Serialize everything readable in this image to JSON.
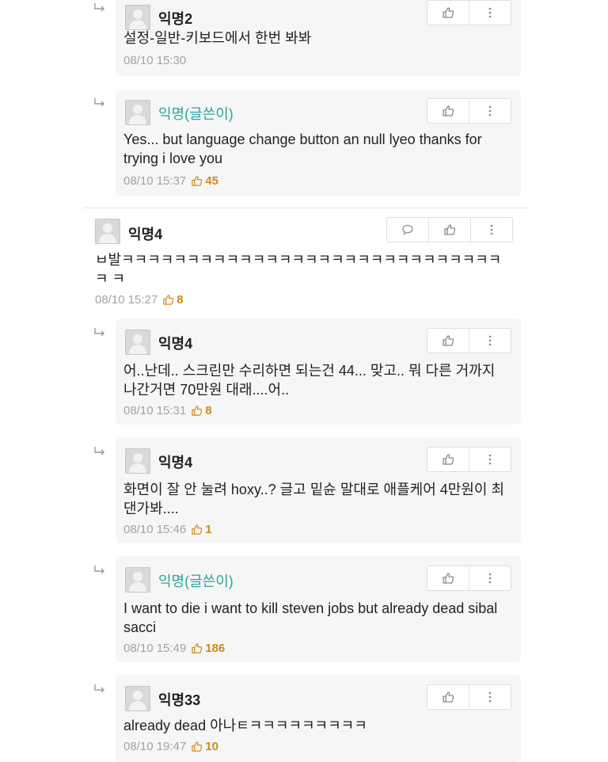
{
  "comments": [
    {
      "author": "익명2",
      "text": "설정-일반-키보드에서 한번 봐봐",
      "time": "08/10 15:30",
      "likes": ""
    },
    {
      "author": "익명(글쓴이)",
      "text": "Yes... but language change button an null lyeo thanks for trying i love you",
      "time": "08/10 15:37",
      "likes": "45"
    },
    {
      "author": "익명4",
      "text": "ㅂ발ㅋㅋㅋㅋㅋㅋㅋㅋㅋㅋㅋㅋㅋㅋㅋㅋㅋㅋㅋㅋㅋㅋㅋㅋㅋㅋㅋㅋㅋㅋ ㅋ",
      "time": "08/10 15:27",
      "likes": "8"
    },
    {
      "author": "익명4",
      "text": "어..난데.. 스크린만 수리하면 되는건 44... 맞고.. 뭐 다른 거까지 나간거면 70만원 대래....어..",
      "time": "08/10 15:31",
      "likes": "8"
    },
    {
      "author": "익명4",
      "text": "화면이 잘 안 눌려 hoxy..? 글고 밑슌 말대로 애플케어 4만원이 최댄가봐....",
      "time": "08/10 15:46",
      "likes": "1"
    },
    {
      "author": "익명(글쓴이)",
      "text": "I want to die i want to kill steven jobs but already dead sibal sacci",
      "time": "08/10 15:49",
      "likes": "186"
    },
    {
      "author": "익명33",
      "text": "already dead 아나ㅌㅋㅋㅋㅋㅋㅋㅋㅋㅋ",
      "time": "08/10 19:47",
      "likes": "10"
    }
  ]
}
